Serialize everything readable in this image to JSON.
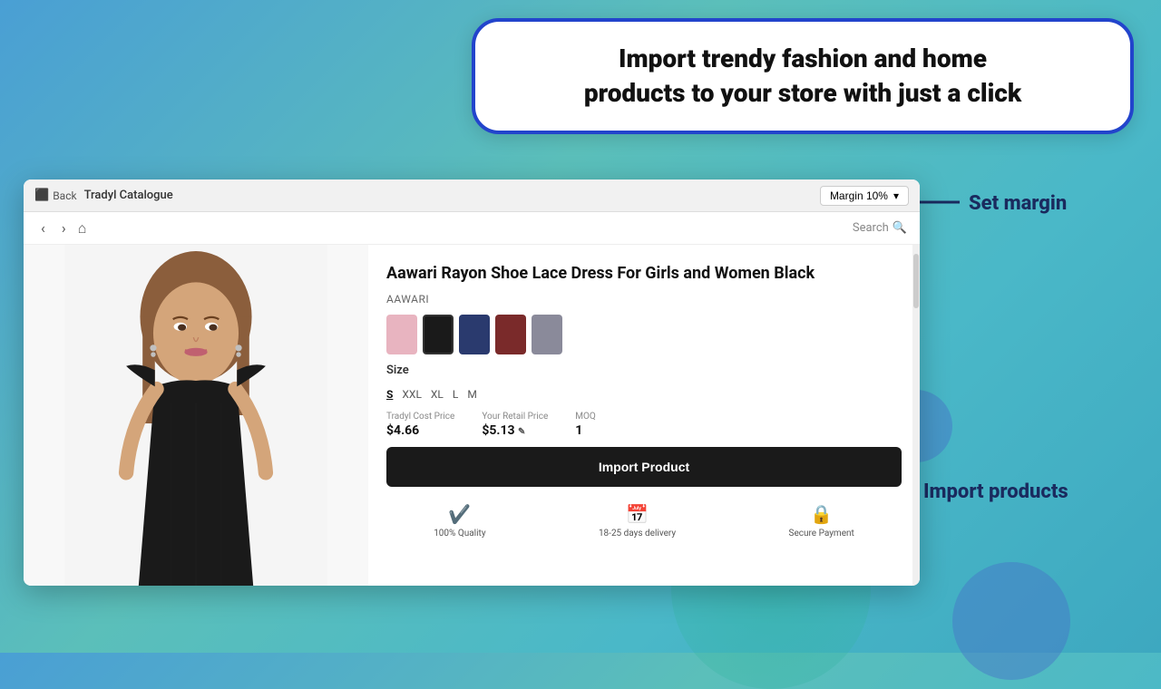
{
  "background": {
    "gradient_start": "#4a9fd4",
    "gradient_end": "#3da8c0"
  },
  "speech_bubble": {
    "text_line1": "Import trendy fashion and home",
    "text_line2": "products to your store with just a click",
    "border_color": "#2244cc"
  },
  "browser": {
    "back_label": "Back",
    "tab_label": "Tradyl Catalogue",
    "margin_btn_label": "Margin 10%",
    "search_placeholder": "Search"
  },
  "product": {
    "title": "Aawari Rayon Shoe Lace Dress For Girls and Women Black",
    "brand": "AAWARI",
    "colors": [
      {
        "name": "pink",
        "hex": "#e8b4c0",
        "active": false
      },
      {
        "name": "black",
        "hex": "#1a1a1a",
        "active": true
      },
      {
        "name": "navy",
        "hex": "#2a3a6e",
        "active": false
      },
      {
        "name": "maroon",
        "hex": "#7a2a2a",
        "active": false
      },
      {
        "name": "grey",
        "hex": "#8a8a9a",
        "active": false
      }
    ],
    "size_label": "Size",
    "sizes": [
      "S",
      "XXL",
      "XL",
      "L",
      "M"
    ],
    "active_size": "S",
    "tradyl_cost_label": "Tradyl Cost Price",
    "tradyl_cost_value": "$4.66",
    "retail_price_label": "Your Retail Price",
    "retail_price_value": "$5.13",
    "moq_label": "MOQ",
    "moq_value": "1",
    "import_btn_label": "Import Product",
    "badges": [
      {
        "icon": "✔",
        "label": "100% Quality"
      },
      {
        "icon": "📦",
        "label": "18-25 days delivery"
      },
      {
        "icon": "🔒",
        "label": "Secure Payment"
      }
    ]
  },
  "annotations": {
    "set_margin_label": "Set margin",
    "import_products_label": "Import products"
  }
}
